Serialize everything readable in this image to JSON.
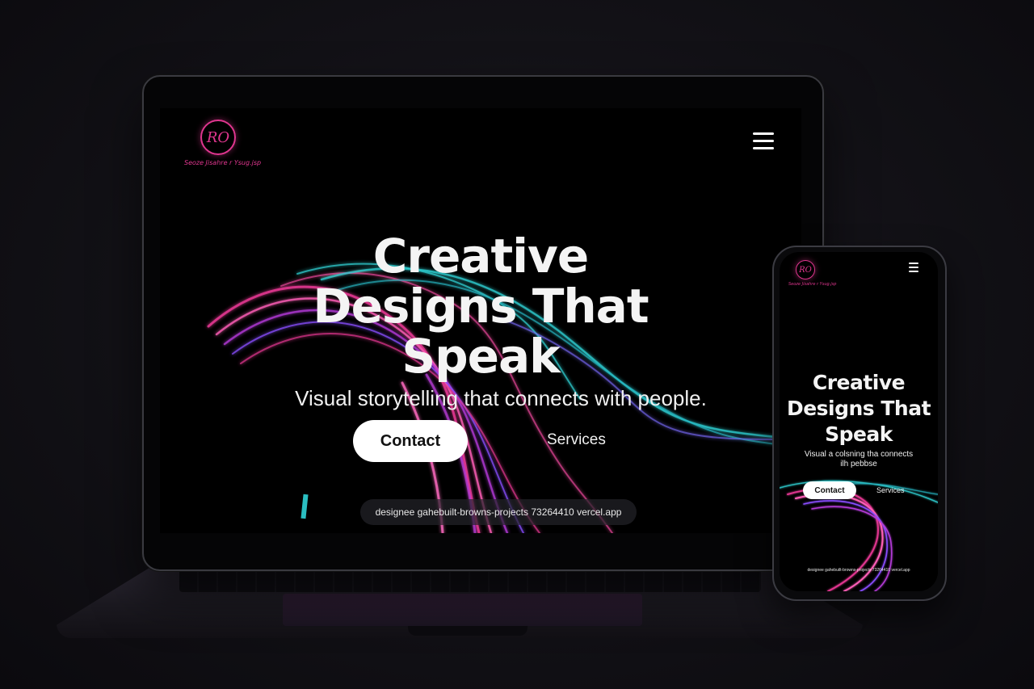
{
  "laptop": {
    "logo": {
      "monogram": "RO",
      "tagline": "Seoze Jisahre r Ysug.jsp"
    },
    "menu_icon": "hamburger-menu-icon",
    "hero": {
      "title_line1": "Creative",
      "title_line2": "Designs That",
      "title_line3": "Speak",
      "subtitle": "Visual storytelling that connects with people."
    },
    "buttons": {
      "contact": "Contact",
      "services": "Services"
    },
    "url": "designee gahebuilt-browns-projects  73264410 vercel.app"
  },
  "phone": {
    "logo": {
      "monogram": "RO",
      "tagline": "Seoze Jisahre r Ysug.jsp"
    },
    "menu_icon": "hamburger-menu-icon",
    "hero": {
      "title_line1": "Creative",
      "title_line2": "Designs That",
      "title_line3": "Speak",
      "subtitle_line1": "Visual a colsning tha connects",
      "subtitle_line2": "ilh pebbse"
    },
    "buttons": {
      "contact": "Contact",
      "services": "Services"
    },
    "url": "designee gahebuilt-browns-projects 73264410 vercel.app"
  },
  "colors": {
    "accent_pink": "#e0368f",
    "accent_cyan": "#2fd3d6",
    "accent_violet": "#8a4dff",
    "background": "#121116"
  }
}
